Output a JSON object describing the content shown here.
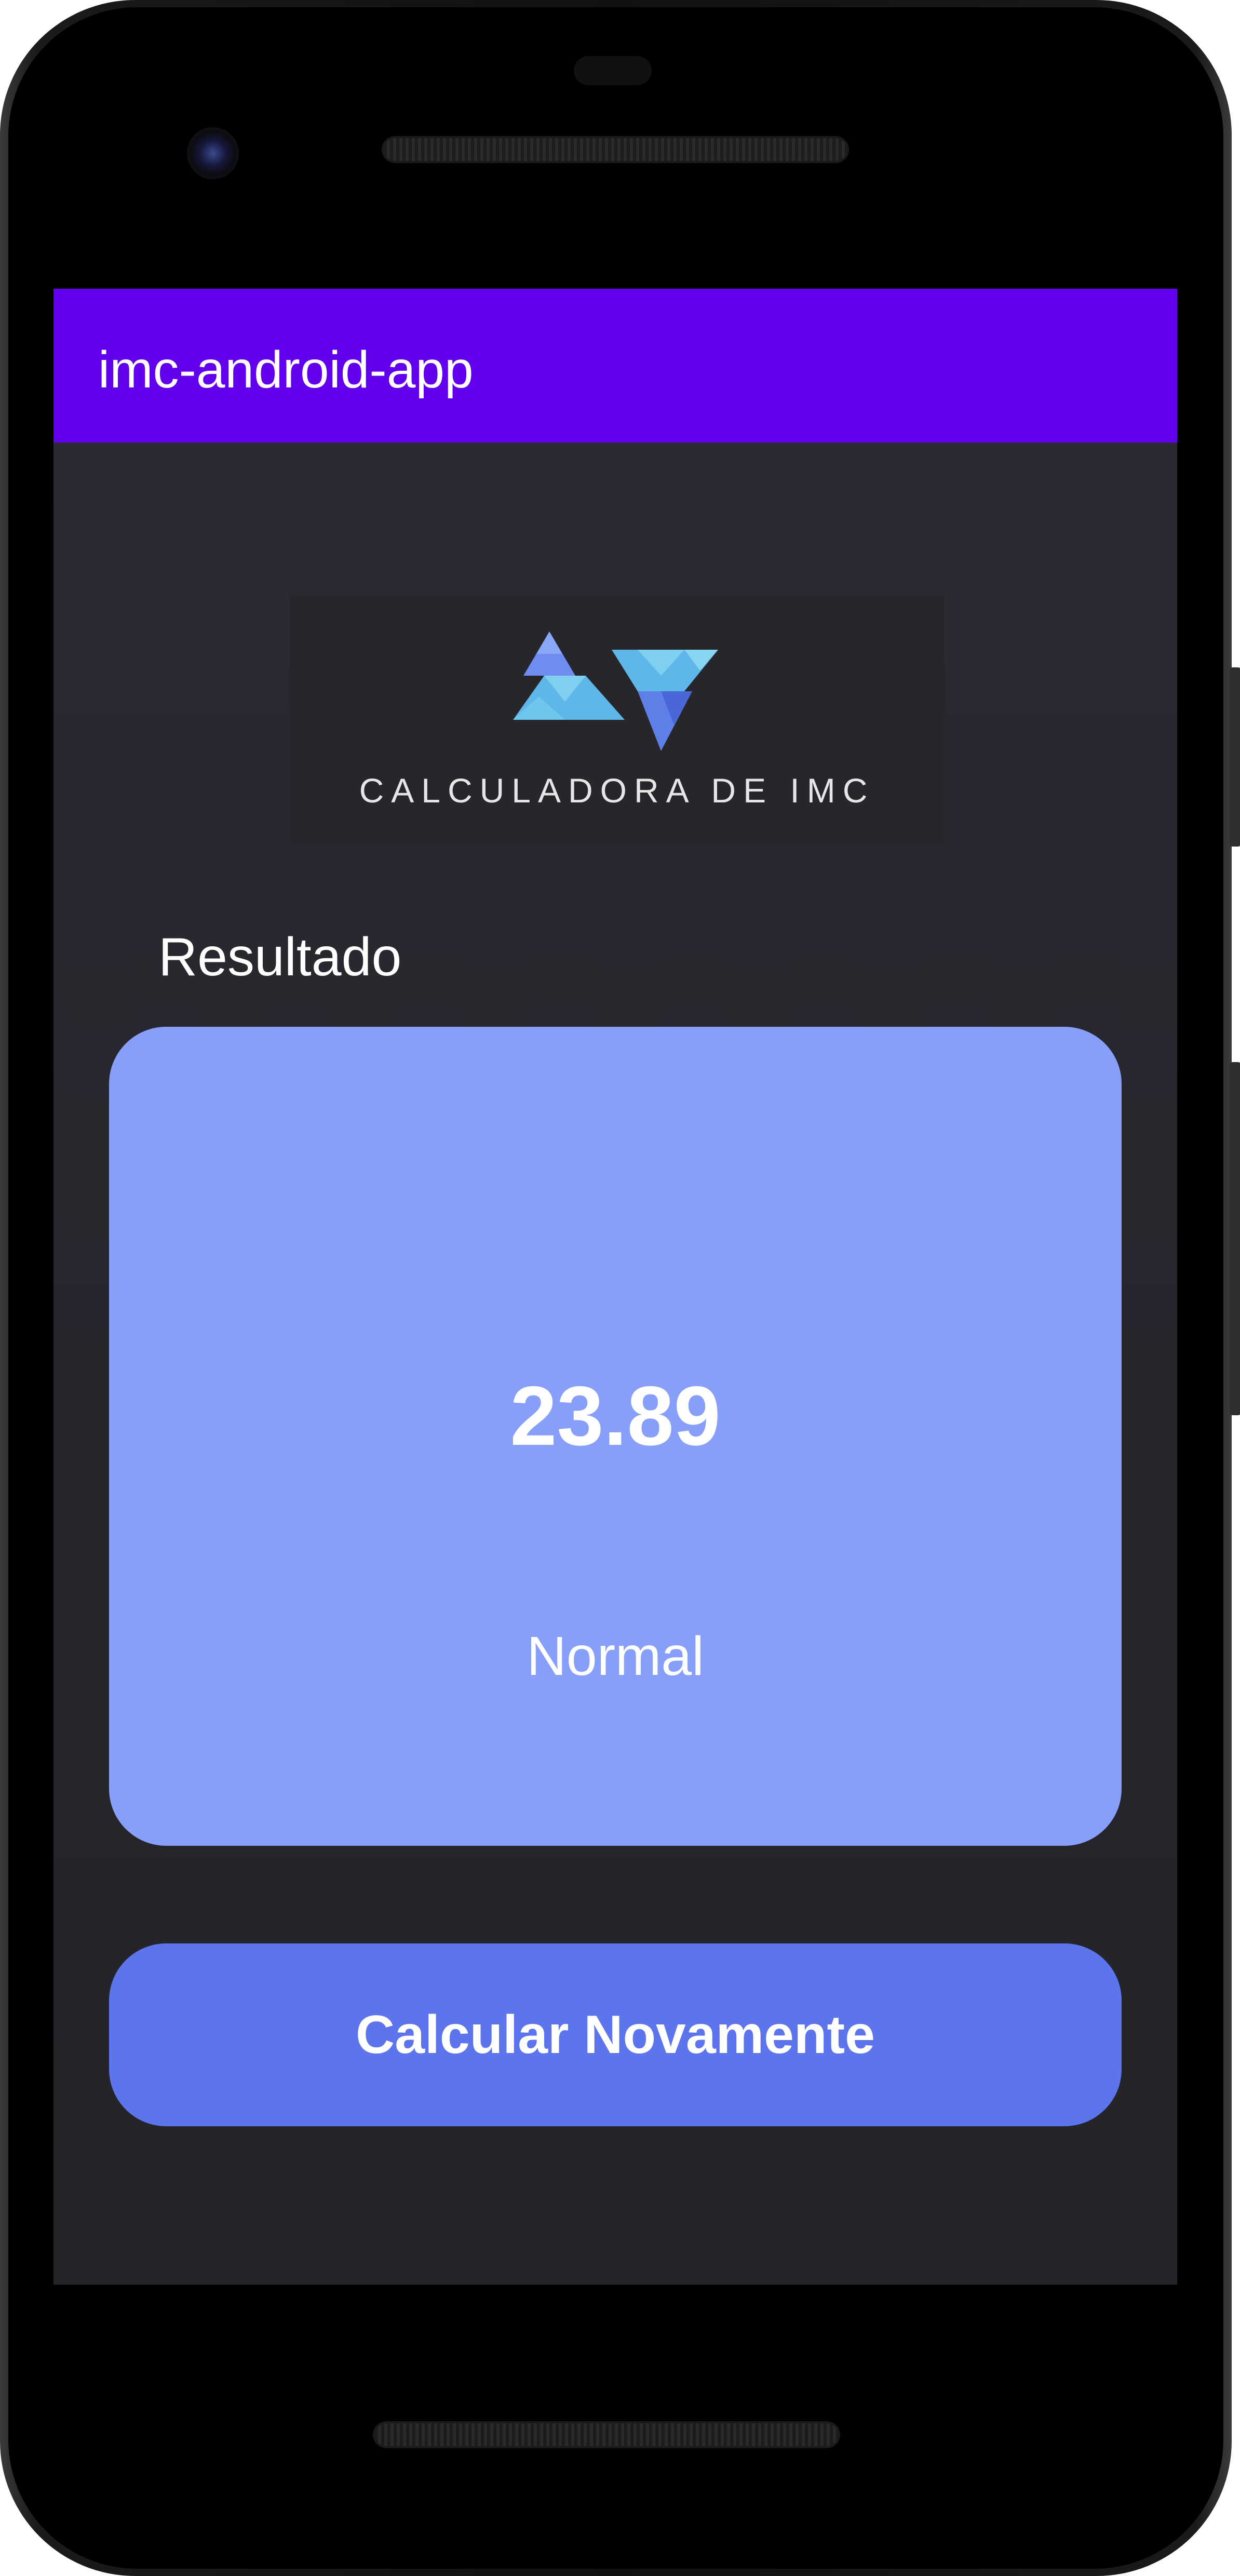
{
  "app_bar": {
    "title": "imc-android-app",
    "background_color": "#6200ee"
  },
  "logo": {
    "text": "CALCULADORA DE IMC",
    "icon": "triangles-logo-icon"
  },
  "result": {
    "section_label": "Resultado",
    "value": "23.89",
    "category": "Normal",
    "card_color": "#889ffa"
  },
  "actions": {
    "recalculate_label": "Calcular Novamente",
    "button_color": "#5c74ec"
  }
}
